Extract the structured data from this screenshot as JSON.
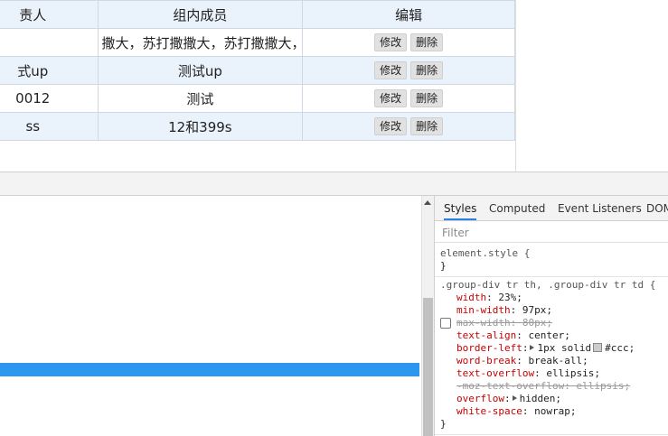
{
  "table": {
    "headers": [
      "责人",
      "组内成员",
      "编辑"
    ],
    "rows": [
      {
        "a": "",
        "b": "撒大，苏打撒撒大，苏打撒撒大，苏打撒撒大，苏打撒撒大，苏打撒",
        "c_edit": "修改",
        "c_delete": "删除"
      },
      {
        "a": "式up",
        "b": "测试up",
        "c_edit": "修改",
        "c_delete": "删除"
      },
      {
        "a": "0012",
        "b": "测试",
        "c_edit": "修改",
        "c_delete": "删除"
      },
      {
        "a": "ss",
        "b": "12和399s",
        "c_edit": "修改",
        "c_delete": "删除"
      }
    ]
  },
  "sidebar": {
    "tabs": [
      "Styles",
      "Computed",
      "Event Listeners",
      "DOM"
    ],
    "filter_placeholder": "Filter",
    "element_style_selector": "element.style {",
    "close_brace": "}",
    "rule_selector": ".group-div tr th, .group-div tr td {",
    "declarations": [
      {
        "prop": "width",
        "val": "23%;"
      },
      {
        "prop": "min-width",
        "val": "97px;"
      },
      {
        "prop": "max-width",
        "val": "80px;"
      },
      {
        "prop": "text-align",
        "val": "center;"
      },
      {
        "prop": "border-left",
        "val": "1px solid",
        "val2": "#ccc;"
      },
      {
        "prop": "word-break",
        "val": "break-all;"
      },
      {
        "prop": "text-overflow",
        "val": "ellipsis;"
      },
      {
        "prop": "-moz-text-overflow",
        "val": "ellipsis;"
      },
      {
        "prop": "overflow",
        "val": "hidden;"
      },
      {
        "prop": "white-space",
        "val": "nowrap;"
      }
    ],
    "colors": {
      "accent": "#2b97f0",
      "prop": "#c80000",
      "swatch": "#ccc"
    }
  }
}
